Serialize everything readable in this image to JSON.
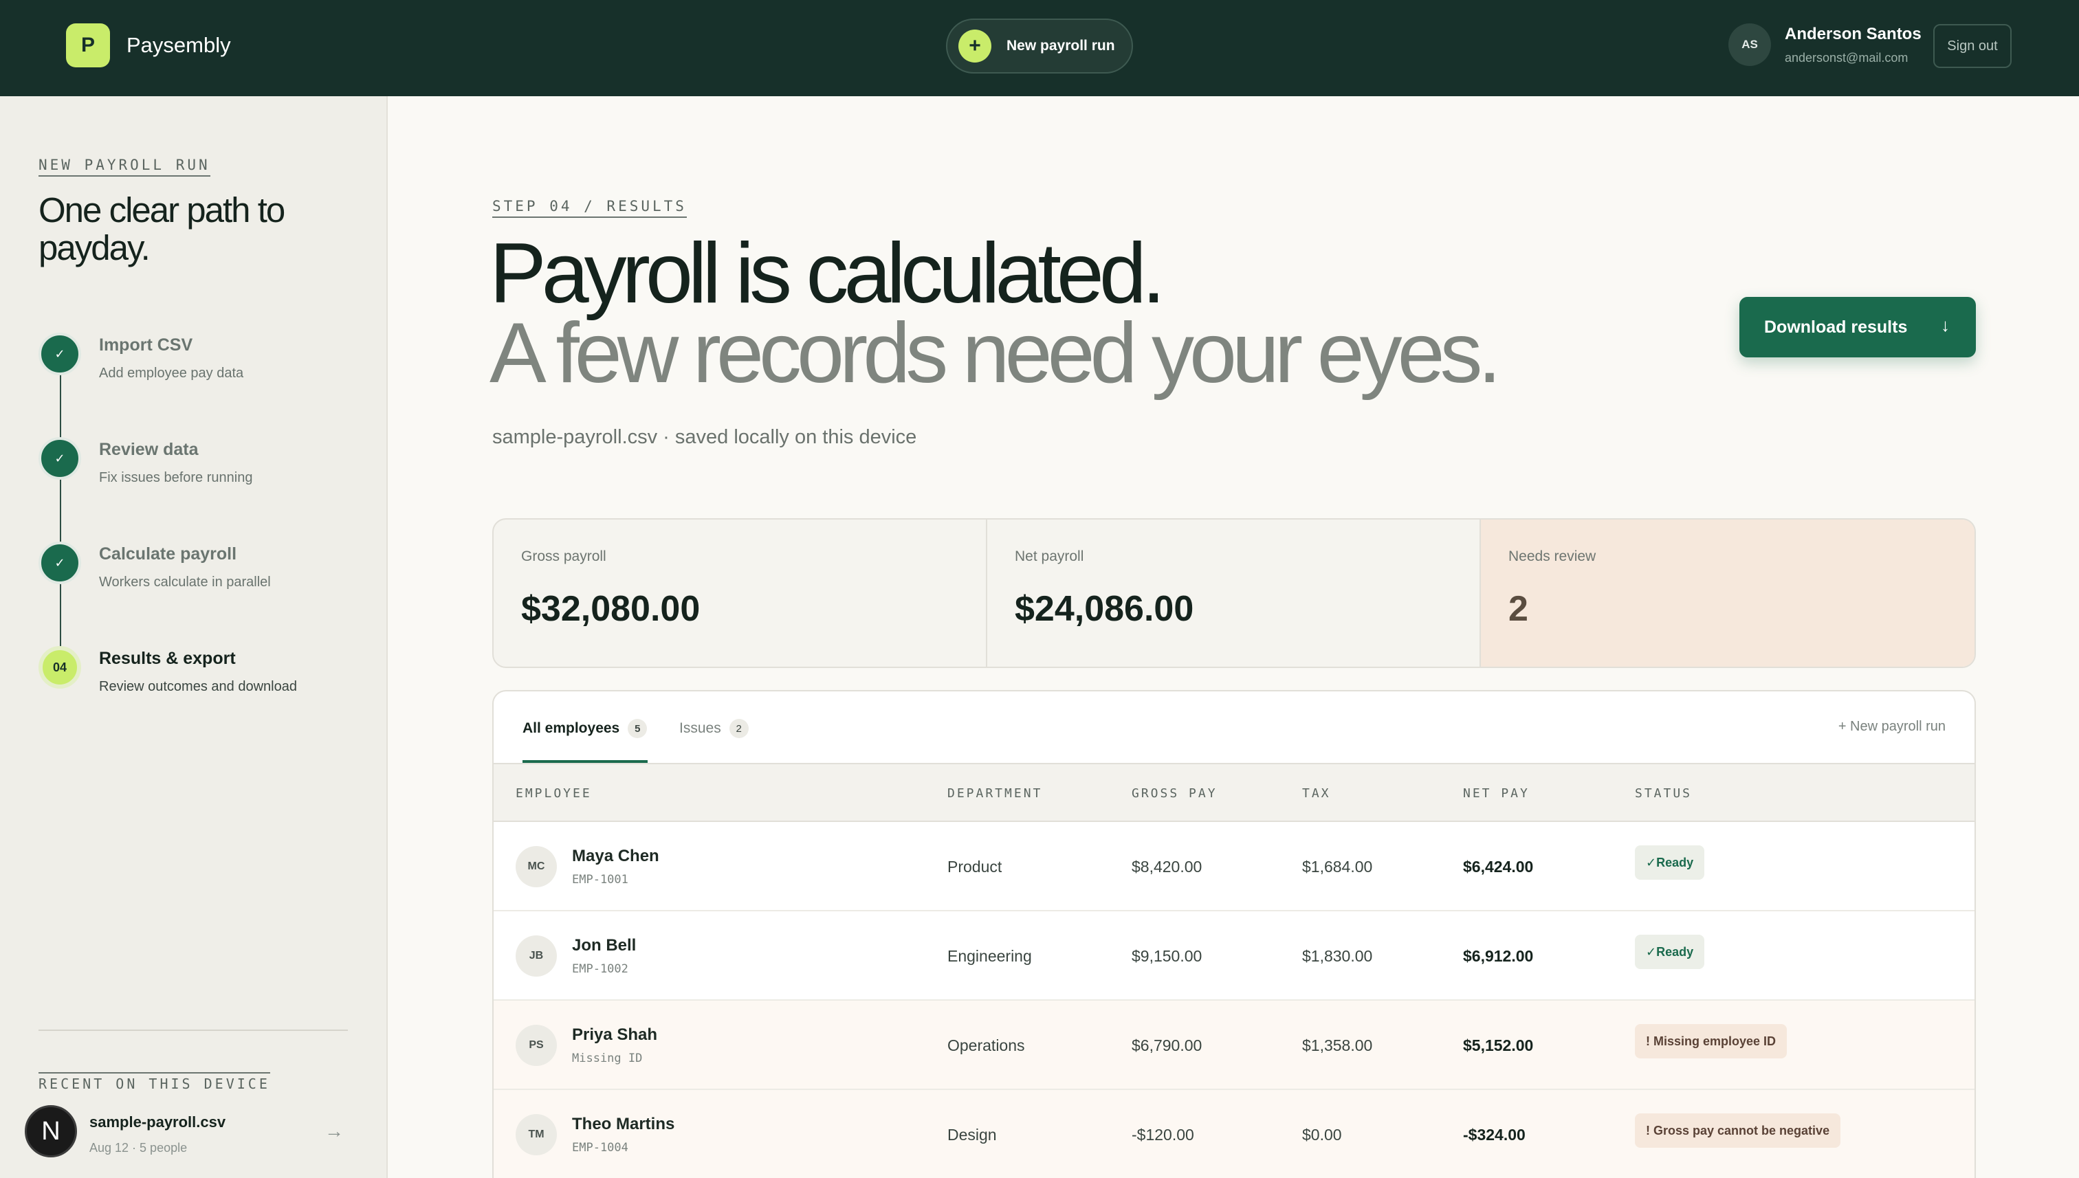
{
  "header": {
    "brand_letter": "P",
    "brand_name": "Paysembly",
    "new_run_label": "New payroll run",
    "user_initials": "AS",
    "user_name": "Anderson Santos",
    "user_email": "andersonst@mail.com",
    "sign_out_label": "Sign out"
  },
  "sidebar": {
    "eyebrow": "NEW PAYROLL RUN",
    "title": "One clear path to payday.",
    "steps": [
      {
        "marker": "✓",
        "title": "Import CSV",
        "subtitle": "Add employee pay data"
      },
      {
        "marker": "✓",
        "title": "Review data",
        "subtitle": "Fix issues before running"
      },
      {
        "marker": "✓",
        "title": "Calculate payroll",
        "subtitle": "Workers calculate in parallel"
      },
      {
        "marker": "04",
        "title": "Results & export",
        "subtitle": "Review outcomes and download"
      }
    ],
    "recent_label": "RECENT ON THIS DEVICE",
    "recent": {
      "avatar": "N",
      "name": "sample-payroll.csv",
      "meta": "Aug 12 · 5 people",
      "arrow": "→"
    }
  },
  "main": {
    "eyebrow": "STEP 04 / RESULTS",
    "headline": "Payroll is calculated.",
    "headline2": "A few records need your eyes.",
    "file_note": "sample-payroll.csv · saved locally on this device",
    "download_label": "Download results",
    "download_arrow": "↓",
    "stats": [
      {
        "label": "Gross payroll",
        "value": "$32,080.00"
      },
      {
        "label": "Net payroll",
        "value": "$24,086.00"
      },
      {
        "label": "Needs review",
        "value": "2"
      }
    ],
    "tabs": [
      {
        "label": "All employees",
        "count": "5"
      },
      {
        "label": "Issues",
        "count": "2"
      }
    ],
    "new_run_link": "+ New payroll run",
    "columns": [
      "EMPLOYEE",
      "DEPARTMENT",
      "GROSS PAY",
      "TAX",
      "NET PAY",
      "STATUS"
    ],
    "rows": [
      {
        "initials": "MC",
        "name": "Maya Chen",
        "id": "EMP-1001",
        "department": "Product",
        "gross": "$8,420.00",
        "tax": "$1,684.00",
        "net": "$6,424.00",
        "status": "✓Ready"
      },
      {
        "initials": "JB",
        "name": "Jon Bell",
        "id": "EMP-1002",
        "department": "Engineering",
        "gross": "$9,150.00",
        "tax": "$1,830.00",
        "net": "$6,912.00",
        "status": "✓Ready"
      },
      {
        "initials": "PS",
        "name": "Priya Shah",
        "id": "Missing ID",
        "department": "Operations",
        "gross": "$6,790.00",
        "tax": "$1,358.00",
        "net": "$5,152.00",
        "status": "! Missing employee ID"
      },
      {
        "initials": "TM",
        "name": "Theo Martins",
        "id": "EMP-1004",
        "department": "Design",
        "gross": "-$120.00",
        "tax": "$0.00",
        "net": "-$324.00",
        "status": "! Gross pay cannot be negative"
      }
    ]
  }
}
